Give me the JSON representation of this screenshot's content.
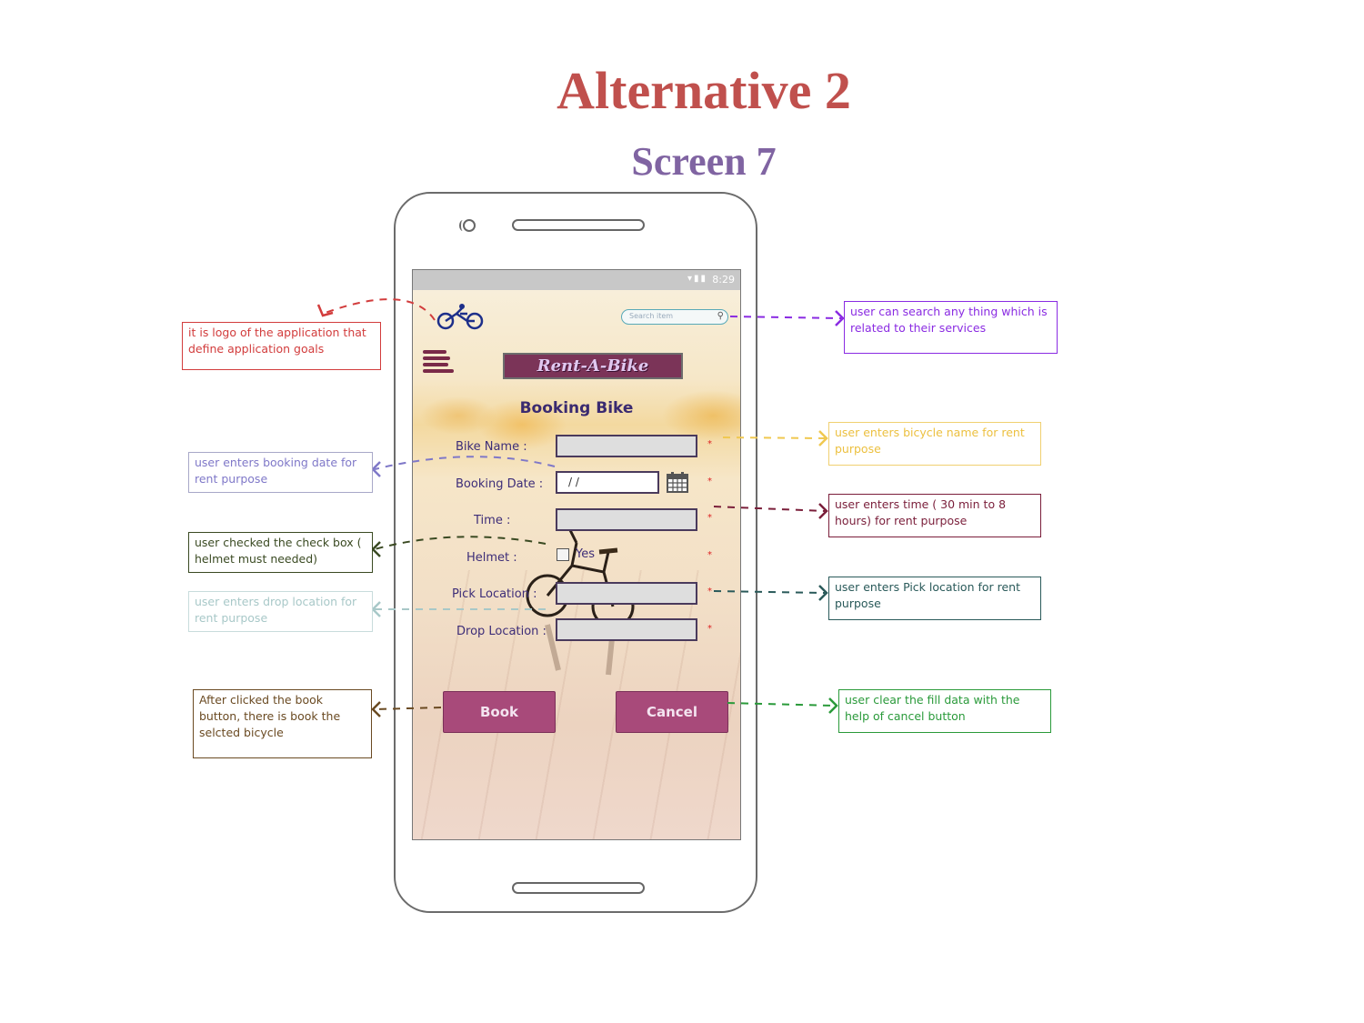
{
  "title": "Alternative 2",
  "subtitle": "Screen 7",
  "phone": {
    "status_bar": {
      "time": "8:29",
      "icons": [
        "wifi-icon",
        "signal-icon",
        "battery-icon"
      ]
    },
    "header": {
      "logo_icon": "bicycle-logo-icon",
      "search_placeholder": "Search item",
      "menu_icon": "hamburger-menu-icon",
      "brand": "Rent-A-Bike"
    },
    "form": {
      "heading": "Booking Bike",
      "fields": [
        {
          "label": "Bike Name :",
          "value": "",
          "required": "*"
        },
        {
          "label": "Booking Date :",
          "value": "/ /",
          "required": "*"
        },
        {
          "label": "Time :",
          "value": "",
          "required": "*"
        },
        {
          "label": "Helmet :",
          "checkbox_label": "Yes",
          "checked": false,
          "required": "*"
        },
        {
          "label": "Pick Location :",
          "value": "",
          "required": "*"
        },
        {
          "label": "Drop Location :",
          "value": "",
          "required": "*"
        }
      ],
      "book_label": "Book",
      "cancel_label": "Cancel"
    }
  },
  "annotations": {
    "logo": {
      "text": "it is logo of the application that define application goals",
      "color": "#d23c3c"
    },
    "search": {
      "text": "user can search any thing which is related to their services",
      "color": "#8a2be2"
    },
    "bike_name": {
      "text": "user enters bicycle name for rent purpose",
      "color": "#f0c850"
    },
    "booking_date": {
      "text": "user enters booking date for rent purpose",
      "color": "#7f78c8"
    },
    "time": {
      "text": "user enters time ( 30 min to 8 hours) for rent purpose",
      "color": "#7a1e3a"
    },
    "helmet": {
      "text": "user checked the check box ( helmet must needed)",
      "color": "#3a4a22"
    },
    "pick_location": {
      "text": "user enters Pick location for rent purpose",
      "color": "#2a5a5a"
    },
    "drop_location": {
      "text": "user enters drop location for rent purpose",
      "color": "#a8c8c8"
    },
    "book": {
      "text": "After clicked the book button, there is book the selcted bicycle",
      "color": "#6a4a22"
    },
    "cancel": {
      "text": "user clear the fill data with the help of cancel button",
      "color": "#2a9a3a"
    }
  }
}
